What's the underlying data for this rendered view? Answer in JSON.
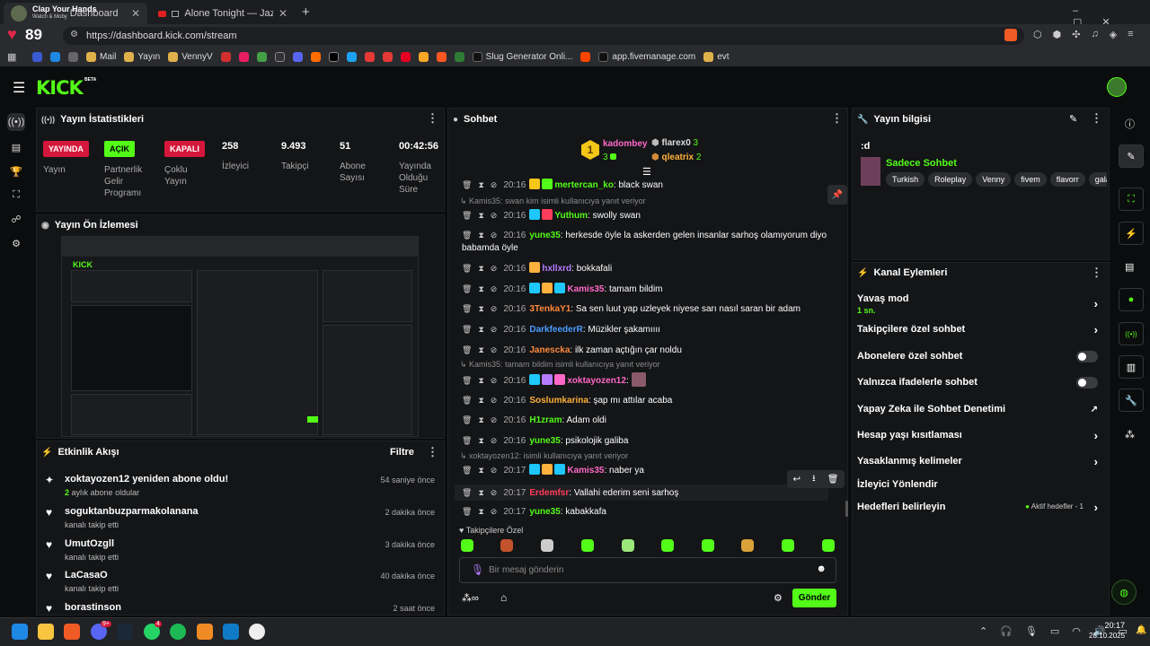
{
  "browser": {
    "tabs": [
      {
        "title": "Dashboard",
        "overlay_title": "Clap Your Hands",
        "overlay_sub": "Watch & Moby"
      },
      {
        "title": "Alone Tonight — Jazz for the Qui"
      }
    ],
    "new_tab": "+",
    "url": "https://dashboard.kick.com/stream",
    "heart_value": "89",
    "bookmarks": [
      "Mail",
      "Yayın",
      "VennyV",
      "Slug Generator Onli...",
      "app.fivemanage.com",
      "evt"
    ]
  },
  "kick": {
    "logo": "KICK",
    "beta": "BETA",
    "stats_panel": {
      "title": "Yayın İstatistikleri",
      "items": [
        {
          "badge": "YAYINDA",
          "badge_color": "#d5173b",
          "label": "Yayın"
        },
        {
          "badge": "AÇIK",
          "badge_color": "#53fc18",
          "label": "Partnerlik Gelir Programı"
        },
        {
          "badge": "KAPALI",
          "badge_color": "#d5173b",
          "label": "Çoklu Yayın"
        },
        {
          "value": "258",
          "label": "İzleyici"
        },
        {
          "value": "9.493",
          "label": "Takipçi"
        },
        {
          "value": "51",
          "label": "Abone Sayısı"
        },
        {
          "value": "00:42:56",
          "label": "Yayında Olduğu Süre"
        }
      ]
    },
    "preview_panel": {
      "title": "Yayın Ön İzlemesi"
    },
    "activity_panel": {
      "title": "Etkinlik Akışı",
      "filter": "Filtre",
      "items": [
        {
          "title": "xoktayozen12 yeniden abone oldu!",
          "sub_highlight": "2",
          "sub": "aylık abone oldular",
          "time": "54 saniye önce",
          "icon": "sparkle-icon"
        },
        {
          "title": "soguktanbuzparmakolanana",
          "sub": "kanalı takip etti",
          "time": "2 dakika önce",
          "icon": "heart-icon"
        },
        {
          "title": "UmutOzgll",
          "sub": "kanalı takip etti",
          "time": "3 dakika önce",
          "icon": "heart-icon"
        },
        {
          "title": "LaCasaO",
          "sub": "kanalı takip etti",
          "time": "40 dakika önce",
          "icon": "heart-icon"
        },
        {
          "title": "borastinson",
          "sub": "",
          "time": "2 saat önce",
          "icon": "heart-icon"
        }
      ]
    },
    "chat_panel": {
      "title": "Sohbet",
      "leaders": [
        {
          "rank": "1",
          "name": "kadombey",
          "count": "3"
        },
        {
          "rank": "2",
          "name": "flarex0",
          "count": "3"
        },
        {
          "rank": "3",
          "name": "qleatrix",
          "count": "2"
        }
      ],
      "messages": [
        {
          "time": "20:16",
          "user": "mertercan_ko",
          "color": "#53fc18",
          "text": "black swan"
        },
        {
          "reply": "Kamis35: swan kim isimli kullanıcıya yanıt veriyor"
        },
        {
          "time": "20:16",
          "user": "Yuthum",
          "color": "#53fc18",
          "text": "swolly swan"
        },
        {
          "time": "20:16",
          "user": "yune35",
          "color": "#53fc18",
          "text": "herkesde öyle la askerden gelen insanlar sarhoş olamıyorum diyo babamda öyle"
        },
        {
          "time": "20:16",
          "user": "hxllxrd",
          "color": "#b57cff",
          "text": "bokkafali"
        },
        {
          "time": "20:16",
          "user": "Kamis35",
          "color": "#ff68c7",
          "text": "tamam bildim"
        },
        {
          "time": "20:16",
          "user": "3TenkaY1",
          "color": "#ff8a3d",
          "text": "Sa sen luut yap uzleyek niyese sarı nasıl saran bir adam"
        },
        {
          "time": "20:16",
          "user": "DarkfeederR",
          "color": "#4a9bff",
          "text": "Müzikler şakamıııı"
        },
        {
          "time": "20:16",
          "user": "Janescka",
          "color": "#ff8a3d",
          "text": "ilk zaman açtığın çar noldu"
        },
        {
          "reply": "Kamis35: tamam bildim isimli kullanıcıya yanıt veriyor"
        },
        {
          "time": "20:16",
          "user": "xoktayozen12",
          "color": "#ff68c7",
          "text": ""
        },
        {
          "time": "20:16",
          "user": "Soslumkarina",
          "color": "#ffb13d",
          "text": "şap mı attılar acaba"
        },
        {
          "time": "20:16",
          "user": "H1zram",
          "color": "#53fc18",
          "text": "Adam oldi"
        },
        {
          "time": "20:16",
          "user": "yune35",
          "color": "#53fc18",
          "text": "psikolojik galiba"
        },
        {
          "reply": "xoktayozen12: isimli kullanıcıya yanıt veriyor"
        },
        {
          "time": "20:17",
          "user": "Kamis35",
          "color": "#ff68c7",
          "text": "naber ya"
        },
        {
          "time": "20:17",
          "user": "Erdemfsr",
          "color": "#ff3d5a",
          "text": "Vallahi ederim seni sarhoş"
        },
        {
          "time": "20:17",
          "user": "yune35",
          "color": "#53fc18",
          "text": "kabakkafa"
        }
      ],
      "followers_only": "Takipçilere Özel",
      "input_placeholder": "Bir mesaj gönderin",
      "send": "Gönder"
    },
    "info_panel": {
      "title": "Yayın bilgisi",
      "stream_title": ":d",
      "category": "Sadece Sohbet",
      "tags": [
        "Turkish",
        "Roleplay",
        "Venny",
        "fivem",
        "flavorr",
        "galax"
      ]
    },
    "actions_panel": {
      "title": "Kanal Eylemleri",
      "items": [
        {
          "label": "Yavaş mod",
          "sub": "1 sn.",
          "control": "chevron"
        },
        {
          "label": "Takipçilere özel sohbet",
          "control": "chevron"
        },
        {
          "label": "Abonelere özel sohbet",
          "control": "toggle"
        },
        {
          "label": "Yalnızca ifadelerle sohbet",
          "control": "toggle"
        },
        {
          "label": "Yapay Zeka ile Sohbet Denetimi",
          "control": "external"
        },
        {
          "label": "Hesap yaşı kısıtlaması",
          "control": "chevron"
        },
        {
          "label": "Yasaklanmış kelimeler",
          "control": "chevron"
        },
        {
          "label": "İzleyici Yönlendir",
          "control": "none"
        },
        {
          "label": "Hedefleri belirleyin",
          "control": "chevron",
          "status": "Aktif hedefler - 1"
        }
      ]
    }
  },
  "taskbar": {
    "time": "20:17",
    "date": "28.10.2025",
    "badge_a": "9+",
    "badge_b": "4"
  }
}
